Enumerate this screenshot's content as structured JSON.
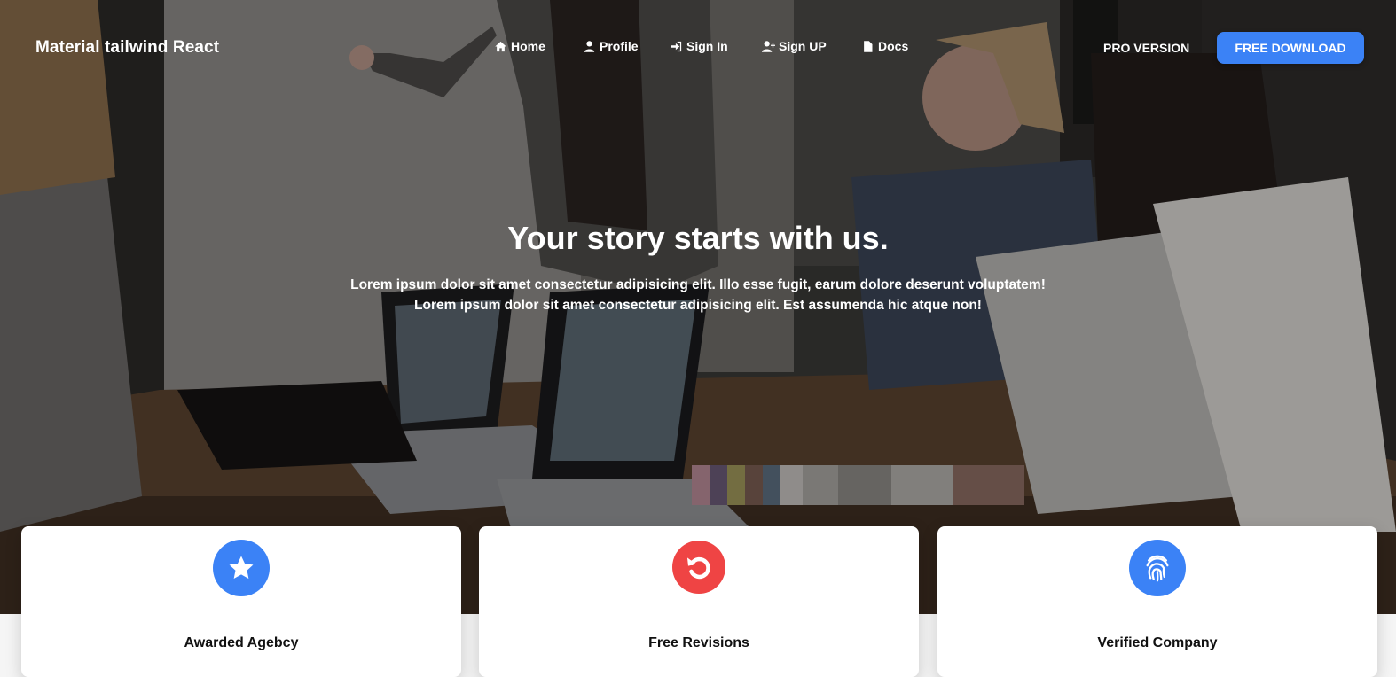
{
  "brand": "Material tailwind React",
  "nav": {
    "items": [
      {
        "label": "Home",
        "icon": "home-icon"
      },
      {
        "label": "Profile",
        "icon": "user-icon"
      },
      {
        "label": "Sign In",
        "icon": "sign-in-icon"
      },
      {
        "label": "Sign UP",
        "icon": "user-plus-icon"
      },
      {
        "label": "Docs",
        "icon": "file-icon"
      }
    ],
    "pro_label": "PRO VERSION",
    "download_label": "FREE DOWNLOAD"
  },
  "hero": {
    "title": "Your story starts with us.",
    "subtitle_line1": "Lorem ipsum dolor sit amet consectetur adipisicing elit. Illo esse fugit, earum dolore deserunt voluptatem!",
    "subtitle_line2": "Lorem ipsum dolor sit amet consectetur adipisicing elit. Est assumenda hic atque non!"
  },
  "features": [
    {
      "title": "Awarded Agebcy",
      "icon": "star-icon",
      "color": "#3b82f6"
    },
    {
      "title": "Free Revisions",
      "icon": "rotate-icon",
      "color": "#ef4444"
    },
    {
      "title": "Verified Company",
      "icon": "fingerprint-icon",
      "color": "#3b82f6"
    }
  ],
  "colors": {
    "accent": "#3b82f6",
    "danger": "#ef4444"
  }
}
